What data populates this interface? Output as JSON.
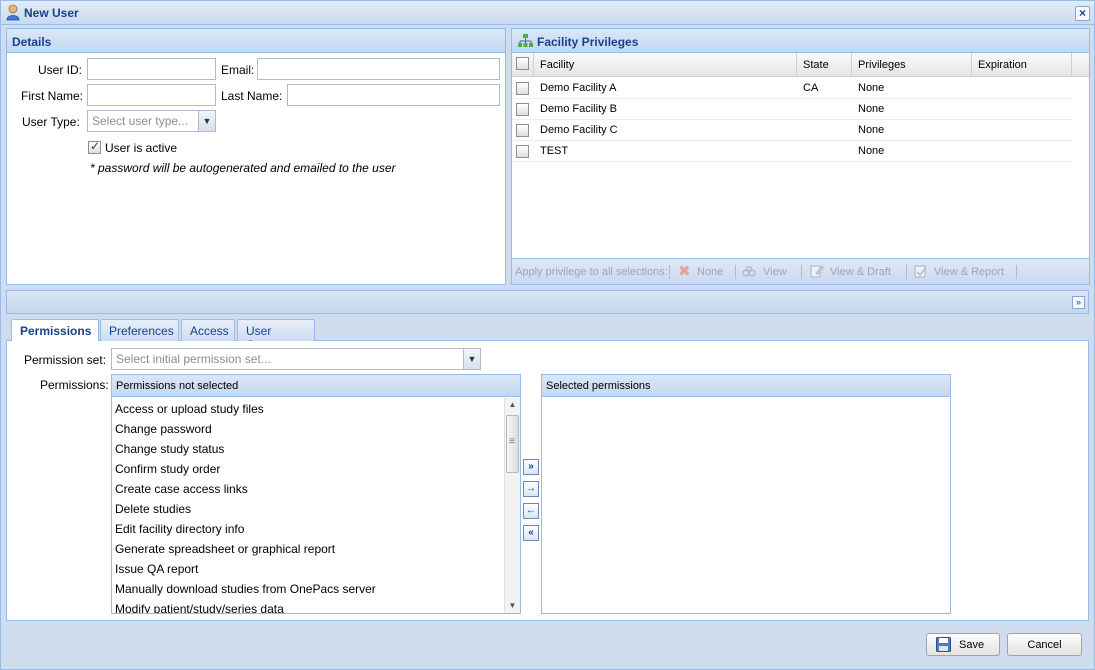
{
  "window": {
    "title": "New User"
  },
  "details": {
    "header": "Details",
    "user_id_label": "User ID:",
    "email_label": "Email:",
    "first_name_label": "First Name:",
    "last_name_label": "Last Name:",
    "user_type_label": "User Type:",
    "user_type_placeholder": "Select user type...",
    "active_label": "User is active",
    "active_checked": true,
    "password_note": "* password will be autogenerated and emailed to the user"
  },
  "facility": {
    "header": "Facility Privileges",
    "columns": [
      "Facility",
      "State",
      "Privileges",
      "Expiration"
    ],
    "rows": [
      {
        "facility": "Demo Facility A",
        "state": "CA",
        "privileges": "None",
        "expiration": ""
      },
      {
        "facility": "Demo Facility B",
        "state": "",
        "privileges": "None",
        "expiration": ""
      },
      {
        "facility": "Demo Facility C",
        "state": "",
        "privileges": "None",
        "expiration": ""
      },
      {
        "facility": "TEST",
        "state": "",
        "privileges": "None",
        "expiration": ""
      }
    ],
    "toolbar": {
      "apply_label": "Apply privilege to all selections:",
      "none": "None",
      "view": "View",
      "view_draft": "View & Draft",
      "view_report": "View & Report"
    }
  },
  "tabs": [
    "Permissions",
    "Preferences",
    "Access",
    "User Groups"
  ],
  "permissions": {
    "set_label": "Permission set:",
    "set_placeholder": "Select initial permission set...",
    "perm_label": "Permissions:",
    "not_selected_header": "Permissions not selected",
    "selected_header": "Selected permissions",
    "not_selected": [
      "Access or upload study files",
      "Change password",
      "Change study status",
      "Confirm study order",
      "Create case access links",
      "Delete studies",
      "Edit facility directory info",
      "Generate spreadsheet or graphical report",
      "Issue QA report",
      "Manually download studies from OnePacs server",
      "Modify patient/study/series data"
    ]
  },
  "footer": {
    "save": "Save",
    "cancel": "Cancel"
  }
}
